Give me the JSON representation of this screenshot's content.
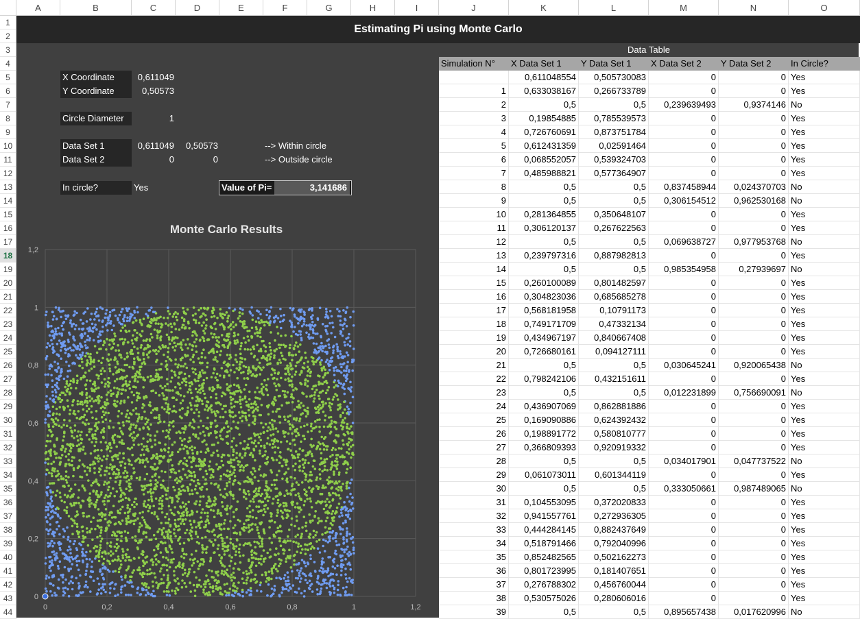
{
  "columns": [
    "A",
    "B",
    "C",
    "D",
    "E",
    "F",
    "G",
    "H",
    "I",
    "J",
    "K",
    "L",
    "M",
    "N",
    "O"
  ],
  "selected_row": 18,
  "title": "Estimating Pi using Monte Carlo",
  "inputs": {
    "x_label": "X Coordinate",
    "x_value": "0,611049",
    "y_label": "Y Coordinate",
    "y_value": "0,50573",
    "diam_label": "Circle Diameter",
    "diam_value": "1",
    "ds1_label": "Data Set 1",
    "ds1_x": "0,611049",
    "ds1_y": "0,50573",
    "ds1_note": "--> Within circle",
    "ds2_label": "Data Set 2",
    "ds2_x": "0",
    "ds2_y": "0",
    "ds2_note": "--> Outside circle",
    "incircle_label": "In circle?",
    "incircle_value": "Yes",
    "pi_label": "Value of Pi=",
    "pi_value": "3,141686"
  },
  "chart_data": {
    "type": "scatter",
    "title": "Monte Carlo Results",
    "xlim": [
      0,
      1.2
    ],
    "ylim": [
      0,
      1.2
    ],
    "xticks": [
      "0",
      "0,2",
      "0,4",
      "0,6",
      "0,8",
      "1",
      "1,2"
    ],
    "yticks": [
      "0",
      "0,2",
      "0,4",
      "0,6",
      "0,8",
      "1",
      "1,2"
    ],
    "grid": true,
    "series": [
      {
        "color": "#6f9bf0",
        "points": "uniform random in unit square, outside circle of diameter 1 centered (0.5,0.5)"
      },
      {
        "color": "#8fcf4a",
        "points": "uniform random in unit square, inside circle of diameter 1 centered (0.5,0.5)"
      }
    ]
  },
  "table": {
    "title": "Data Table",
    "headers": [
      "Simulation N°",
      "X Data Set 1",
      "Y Data Set 1",
      "X Data Set 2",
      "Y Data Set 2",
      "In Circle?"
    ],
    "rows": [
      [
        "",
        "0,611048554",
        "0,505730083",
        "0",
        "0",
        "Yes"
      ],
      [
        "1",
        "0,633038167",
        "0,266733789",
        "0",
        "0",
        "Yes"
      ],
      [
        "2",
        "0,5",
        "0,5",
        "0,239639493",
        "0,9374146",
        "No"
      ],
      [
        "3",
        "0,19854885",
        "0,785539573",
        "0",
        "0",
        "Yes"
      ],
      [
        "4",
        "0,726760691",
        "0,873751784",
        "0",
        "0",
        "Yes"
      ],
      [
        "5",
        "0,612431359",
        "0,02591464",
        "0",
        "0",
        "Yes"
      ],
      [
        "6",
        "0,068552057",
        "0,539324703",
        "0",
        "0",
        "Yes"
      ],
      [
        "7",
        "0,485988821",
        "0,577364907",
        "0",
        "0",
        "Yes"
      ],
      [
        "8",
        "0,5",
        "0,5",
        "0,837458944",
        "0,024370703",
        "No"
      ],
      [
        "9",
        "0,5",
        "0,5",
        "0,306154512",
        "0,962530168",
        "No"
      ],
      [
        "10",
        "0,281364855",
        "0,350648107",
        "0",
        "0",
        "Yes"
      ],
      [
        "11",
        "0,306120137",
        "0,267622563",
        "0",
        "0",
        "Yes"
      ],
      [
        "12",
        "0,5",
        "0,5",
        "0,069638727",
        "0,977953768",
        "No"
      ],
      [
        "13",
        "0,239797316",
        "0,887982813",
        "0",
        "0",
        "Yes"
      ],
      [
        "14",
        "0,5",
        "0,5",
        "0,985354958",
        "0,27939697",
        "No"
      ],
      [
        "15",
        "0,260100089",
        "0,801482597",
        "0",
        "0",
        "Yes"
      ],
      [
        "16",
        "0,304823036",
        "0,685685278",
        "0",
        "0",
        "Yes"
      ],
      [
        "17",
        "0,568181958",
        "0,10791173",
        "0",
        "0",
        "Yes"
      ],
      [
        "18",
        "0,749171709",
        "0,47332134",
        "0",
        "0",
        "Yes"
      ],
      [
        "19",
        "0,434967197",
        "0,840667408",
        "0",
        "0",
        "Yes"
      ],
      [
        "20",
        "0,726680161",
        "0,094127111",
        "0",
        "0",
        "Yes"
      ],
      [
        "21",
        "0,5",
        "0,5",
        "0,030645241",
        "0,920065438",
        "No"
      ],
      [
        "22",
        "0,798242106",
        "0,432151611",
        "0",
        "0",
        "Yes"
      ],
      [
        "23",
        "0,5",
        "0,5",
        "0,012231899",
        "0,756690091",
        "No"
      ],
      [
        "24",
        "0,436907069",
        "0,862881886",
        "0",
        "0",
        "Yes"
      ],
      [
        "25",
        "0,169090886",
        "0,624392432",
        "0",
        "0",
        "Yes"
      ],
      [
        "26",
        "0,198891772",
        "0,580810777",
        "0",
        "0",
        "Yes"
      ],
      [
        "27",
        "0,366809393",
        "0,920919332",
        "0",
        "0",
        "Yes"
      ],
      [
        "28",
        "0,5",
        "0,5",
        "0,034017901",
        "0,047737522",
        "No"
      ],
      [
        "29",
        "0,061073011",
        "0,601344119",
        "0",
        "0",
        "Yes"
      ],
      [
        "30",
        "0,5",
        "0,5",
        "0,333050661",
        "0,987489065",
        "No"
      ],
      [
        "31",
        "0,104553095",
        "0,372020833",
        "0",
        "0",
        "Yes"
      ],
      [
        "32",
        "0,941557761",
        "0,272936305",
        "0",
        "0",
        "Yes"
      ],
      [
        "33",
        "0,444284145",
        "0,882437649",
        "0",
        "0",
        "Yes"
      ],
      [
        "34",
        "0,518791466",
        "0,792040996",
        "0",
        "0",
        "Yes"
      ],
      [
        "35",
        "0,852482565",
        "0,502162273",
        "0",
        "0",
        "Yes"
      ],
      [
        "36",
        "0,801723995",
        "0,181407651",
        "0",
        "0",
        "Yes"
      ],
      [
        "37",
        "0,276788302",
        "0,456760044",
        "0",
        "0",
        "Yes"
      ],
      [
        "38",
        "0,530575026",
        "0,280606016",
        "0",
        "0",
        "Yes"
      ],
      [
        "39",
        "0,5",
        "0,5",
        "0,895657438",
        "0,017620996",
        "No"
      ]
    ]
  }
}
